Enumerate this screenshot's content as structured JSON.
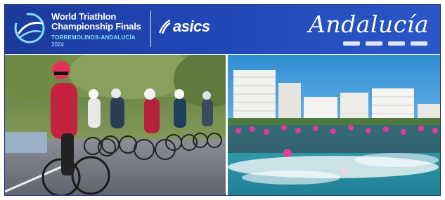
{
  "banner": {
    "title_line1": "World Triathlon",
    "title_line2": "Championship Finals",
    "location": "TORREMOLINOS-ANDALUCÍA",
    "year": "2024",
    "sponsor": "asics",
    "region": "Andalucía"
  },
  "photos": {
    "left_description": "cycling",
    "right_description": "swimming"
  },
  "colors": {
    "banner_blue": "#2146b6",
    "accent_cyan": "#7fe0ff",
    "white": "#ffffff"
  },
  "icons": {
    "event_logo": "triathlon-swirl-logo",
    "sponsor_logo": "asics-stripes-logo"
  }
}
